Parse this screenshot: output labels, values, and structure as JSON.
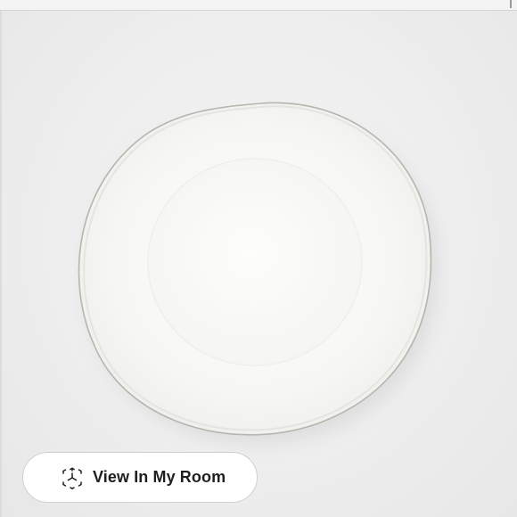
{
  "product": {
    "image_name": "white-dinner-plate"
  },
  "ar_button": {
    "label": "View In My Room",
    "icon": "ar-cube-icon"
  }
}
